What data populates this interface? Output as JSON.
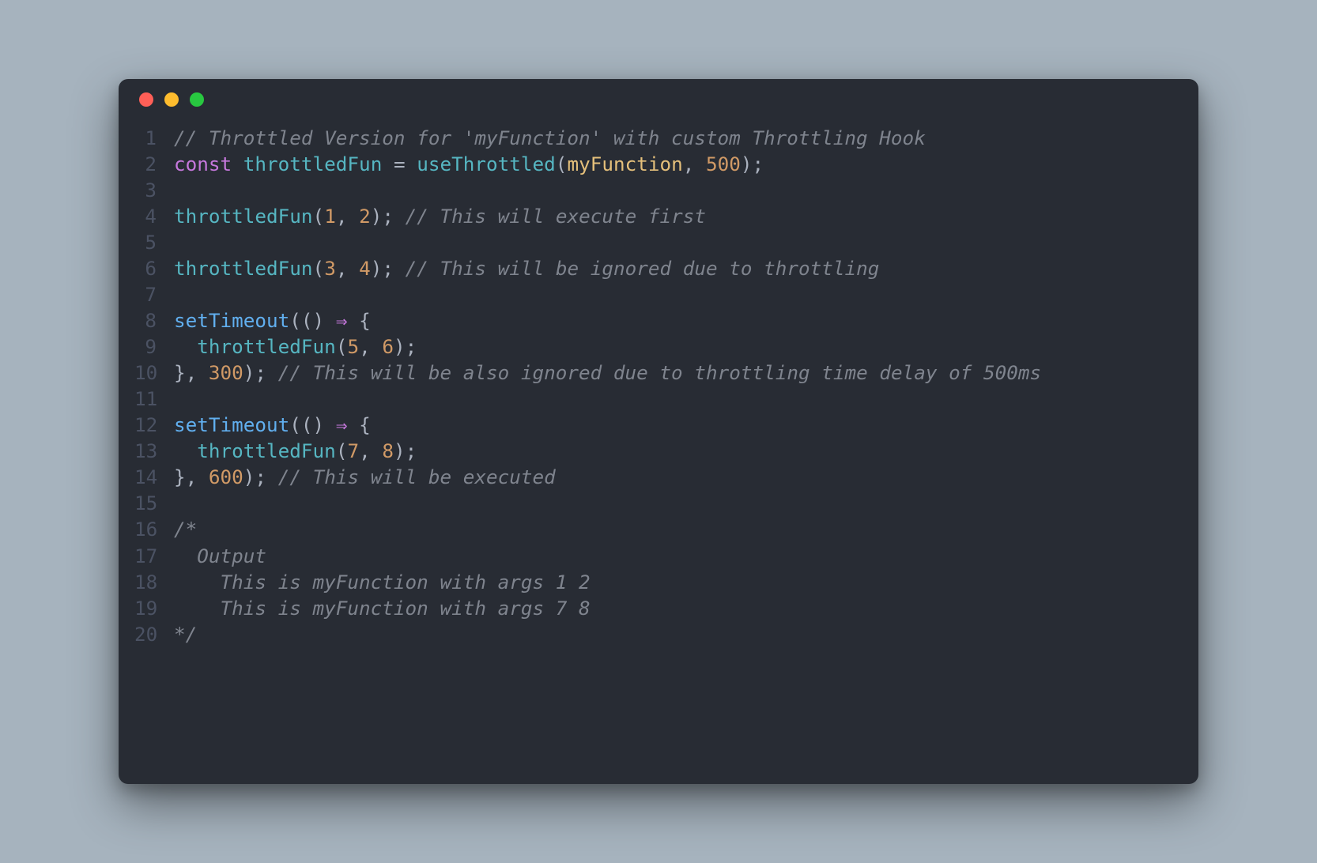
{
  "window": {
    "traffic_lights": [
      "close",
      "minimize",
      "zoom"
    ]
  },
  "editor": {
    "lines": [
      {
        "n": 1,
        "tokens": [
          {
            "t": "comment",
            "v": "// Throttled Version for 'myFunction' with custom Throttling Hook"
          }
        ]
      },
      {
        "n": 2,
        "tokens": [
          {
            "t": "const",
            "v": "const"
          },
          {
            "t": "plain",
            "v": " "
          },
          {
            "t": "fn-decl",
            "v": "throttledFun"
          },
          {
            "t": "plain",
            "v": " "
          },
          {
            "t": "punct",
            "v": "="
          },
          {
            "t": "plain",
            "v": " "
          },
          {
            "t": "fn-call",
            "v": "useThrottled"
          },
          {
            "t": "punct",
            "v": "("
          },
          {
            "t": "ident",
            "v": "myFunction"
          },
          {
            "t": "punct",
            "v": ","
          },
          {
            "t": "plain",
            "v": " "
          },
          {
            "t": "num",
            "v": "500"
          },
          {
            "t": "punct",
            "v": ");"
          }
        ]
      },
      {
        "n": 3,
        "tokens": []
      },
      {
        "n": 4,
        "tokens": [
          {
            "t": "fn-call",
            "v": "throttledFun"
          },
          {
            "t": "punct",
            "v": "("
          },
          {
            "t": "num",
            "v": "1"
          },
          {
            "t": "punct",
            "v": ","
          },
          {
            "t": "plain",
            "v": " "
          },
          {
            "t": "num",
            "v": "2"
          },
          {
            "t": "punct",
            "v": ");"
          },
          {
            "t": "plain",
            "v": " "
          },
          {
            "t": "comment",
            "v": "// This will execute first"
          }
        ]
      },
      {
        "n": 5,
        "tokens": []
      },
      {
        "n": 6,
        "tokens": [
          {
            "t": "fn-call",
            "v": "throttledFun"
          },
          {
            "t": "punct",
            "v": "("
          },
          {
            "t": "num",
            "v": "3"
          },
          {
            "t": "punct",
            "v": ","
          },
          {
            "t": "plain",
            "v": " "
          },
          {
            "t": "num",
            "v": "4"
          },
          {
            "t": "punct",
            "v": ");"
          },
          {
            "t": "plain",
            "v": " "
          },
          {
            "t": "comment",
            "v": "// This will be ignored due to throttling"
          }
        ]
      },
      {
        "n": 7,
        "tokens": []
      },
      {
        "n": 8,
        "tokens": [
          {
            "t": "builtin",
            "v": "setTimeout"
          },
          {
            "t": "punct",
            "v": "(()"
          },
          {
            "t": "plain",
            "v": " "
          },
          {
            "t": "arrow",
            "v": "⇒"
          },
          {
            "t": "plain",
            "v": " "
          },
          {
            "t": "punct",
            "v": "{"
          }
        ]
      },
      {
        "n": 9,
        "tokens": [
          {
            "t": "plain",
            "v": "  "
          },
          {
            "t": "fn-call",
            "v": "throttledFun"
          },
          {
            "t": "punct",
            "v": "("
          },
          {
            "t": "num",
            "v": "5"
          },
          {
            "t": "punct",
            "v": ","
          },
          {
            "t": "plain",
            "v": " "
          },
          {
            "t": "num",
            "v": "6"
          },
          {
            "t": "punct",
            "v": ");"
          }
        ]
      },
      {
        "n": 10,
        "tokens": [
          {
            "t": "punct",
            "v": "},"
          },
          {
            "t": "plain",
            "v": " "
          },
          {
            "t": "num",
            "v": "300"
          },
          {
            "t": "punct",
            "v": ");"
          },
          {
            "t": "plain",
            "v": " "
          },
          {
            "t": "comment",
            "v": "// This will be also ignored due to throttling time delay of 500ms"
          }
        ]
      },
      {
        "n": 11,
        "tokens": []
      },
      {
        "n": 12,
        "tokens": [
          {
            "t": "builtin",
            "v": "setTimeout"
          },
          {
            "t": "punct",
            "v": "(()"
          },
          {
            "t": "plain",
            "v": " "
          },
          {
            "t": "arrow",
            "v": "⇒"
          },
          {
            "t": "plain",
            "v": " "
          },
          {
            "t": "punct",
            "v": "{"
          }
        ]
      },
      {
        "n": 13,
        "tokens": [
          {
            "t": "plain",
            "v": "  "
          },
          {
            "t": "fn-call",
            "v": "throttledFun"
          },
          {
            "t": "punct",
            "v": "("
          },
          {
            "t": "num",
            "v": "7"
          },
          {
            "t": "punct",
            "v": ","
          },
          {
            "t": "plain",
            "v": " "
          },
          {
            "t": "num",
            "v": "8"
          },
          {
            "t": "punct",
            "v": ");"
          }
        ]
      },
      {
        "n": 14,
        "tokens": [
          {
            "t": "punct",
            "v": "},"
          },
          {
            "t": "plain",
            "v": " "
          },
          {
            "t": "num",
            "v": "600"
          },
          {
            "t": "punct",
            "v": ");"
          },
          {
            "t": "plain",
            "v": " "
          },
          {
            "t": "comment",
            "v": "// This will be executed"
          }
        ]
      },
      {
        "n": 15,
        "tokens": []
      },
      {
        "n": 16,
        "tokens": [
          {
            "t": "comment",
            "v": "/*"
          }
        ]
      },
      {
        "n": 17,
        "tokens": [
          {
            "t": "comment",
            "v": "  Output"
          }
        ]
      },
      {
        "n": 18,
        "tokens": [
          {
            "t": "comment",
            "v": "    This is myFunction with args 1 2"
          }
        ]
      },
      {
        "n": 19,
        "tokens": [
          {
            "t": "comment",
            "v": "    This is myFunction with args 7 8"
          }
        ]
      },
      {
        "n": 20,
        "tokens": [
          {
            "t": "comment",
            "v": "*/"
          }
        ]
      }
    ]
  }
}
